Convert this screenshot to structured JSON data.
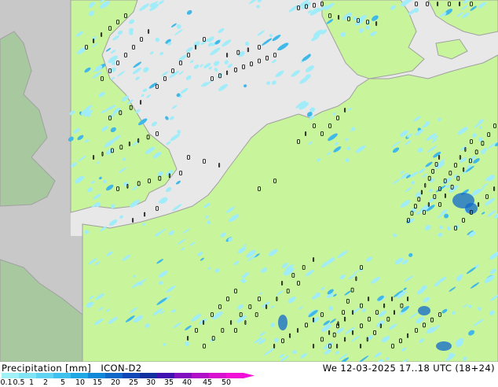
{
  "title": {
    "quantity": "Precipitation [mm]",
    "model": "ICON-D2",
    "valid_time": "We 12-03-2025 17..18 UTC (18+24)"
  },
  "legend": {
    "ticks": [
      "0.1",
      "0.5",
      "1",
      "2",
      "5",
      "10",
      "15",
      "20",
      "25",
      "30",
      "35",
      "40",
      "45",
      "50"
    ],
    "colors": [
      "#a0f0f8",
      "#80e4f4",
      "#60d4f0",
      "#40c0ec",
      "#20a8e4",
      "#1088d8",
      "#1068c8",
      "#1048b8",
      "#1030a0",
      "#4010b0",
      "#8010c0",
      "#b010c8",
      "#d810d0",
      "#f010d8"
    ]
  },
  "map_colors": {
    "land": "#c8f49c",
    "sea": "#e8e8e8",
    "outside_domain": "#c8c8c8",
    "outside_land": "#a8c8a0",
    "coast": "#a0a0a0",
    "light_precip": "#a0ecf8",
    "moderate_precip": "#40b8e8",
    "heavy_precip": "#1068c8",
    "contour": "#000000"
  }
}
